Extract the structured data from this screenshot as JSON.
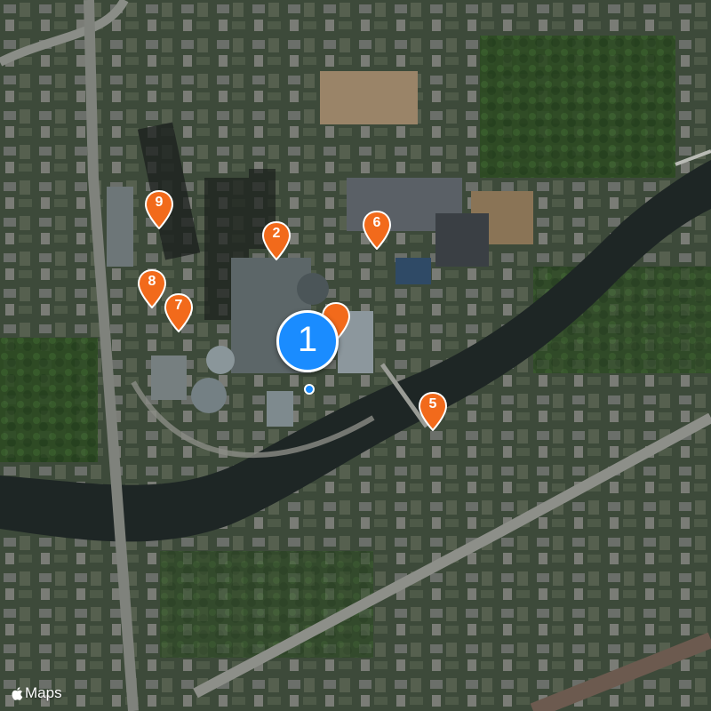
{
  "map": {
    "type": "satellite",
    "attribution": "Maps",
    "attribution_icon": "apple-logo-icon",
    "accent_pin_color": "#f26a1b",
    "selected_pin_color": "#1a8cff"
  },
  "selected_marker": {
    "label": "1"
  },
  "markers": [
    {
      "label": "2"
    },
    {
      "label": "5"
    },
    {
      "label": "6"
    },
    {
      "label": "7"
    },
    {
      "label": "8"
    },
    {
      "label": "9"
    }
  ]
}
